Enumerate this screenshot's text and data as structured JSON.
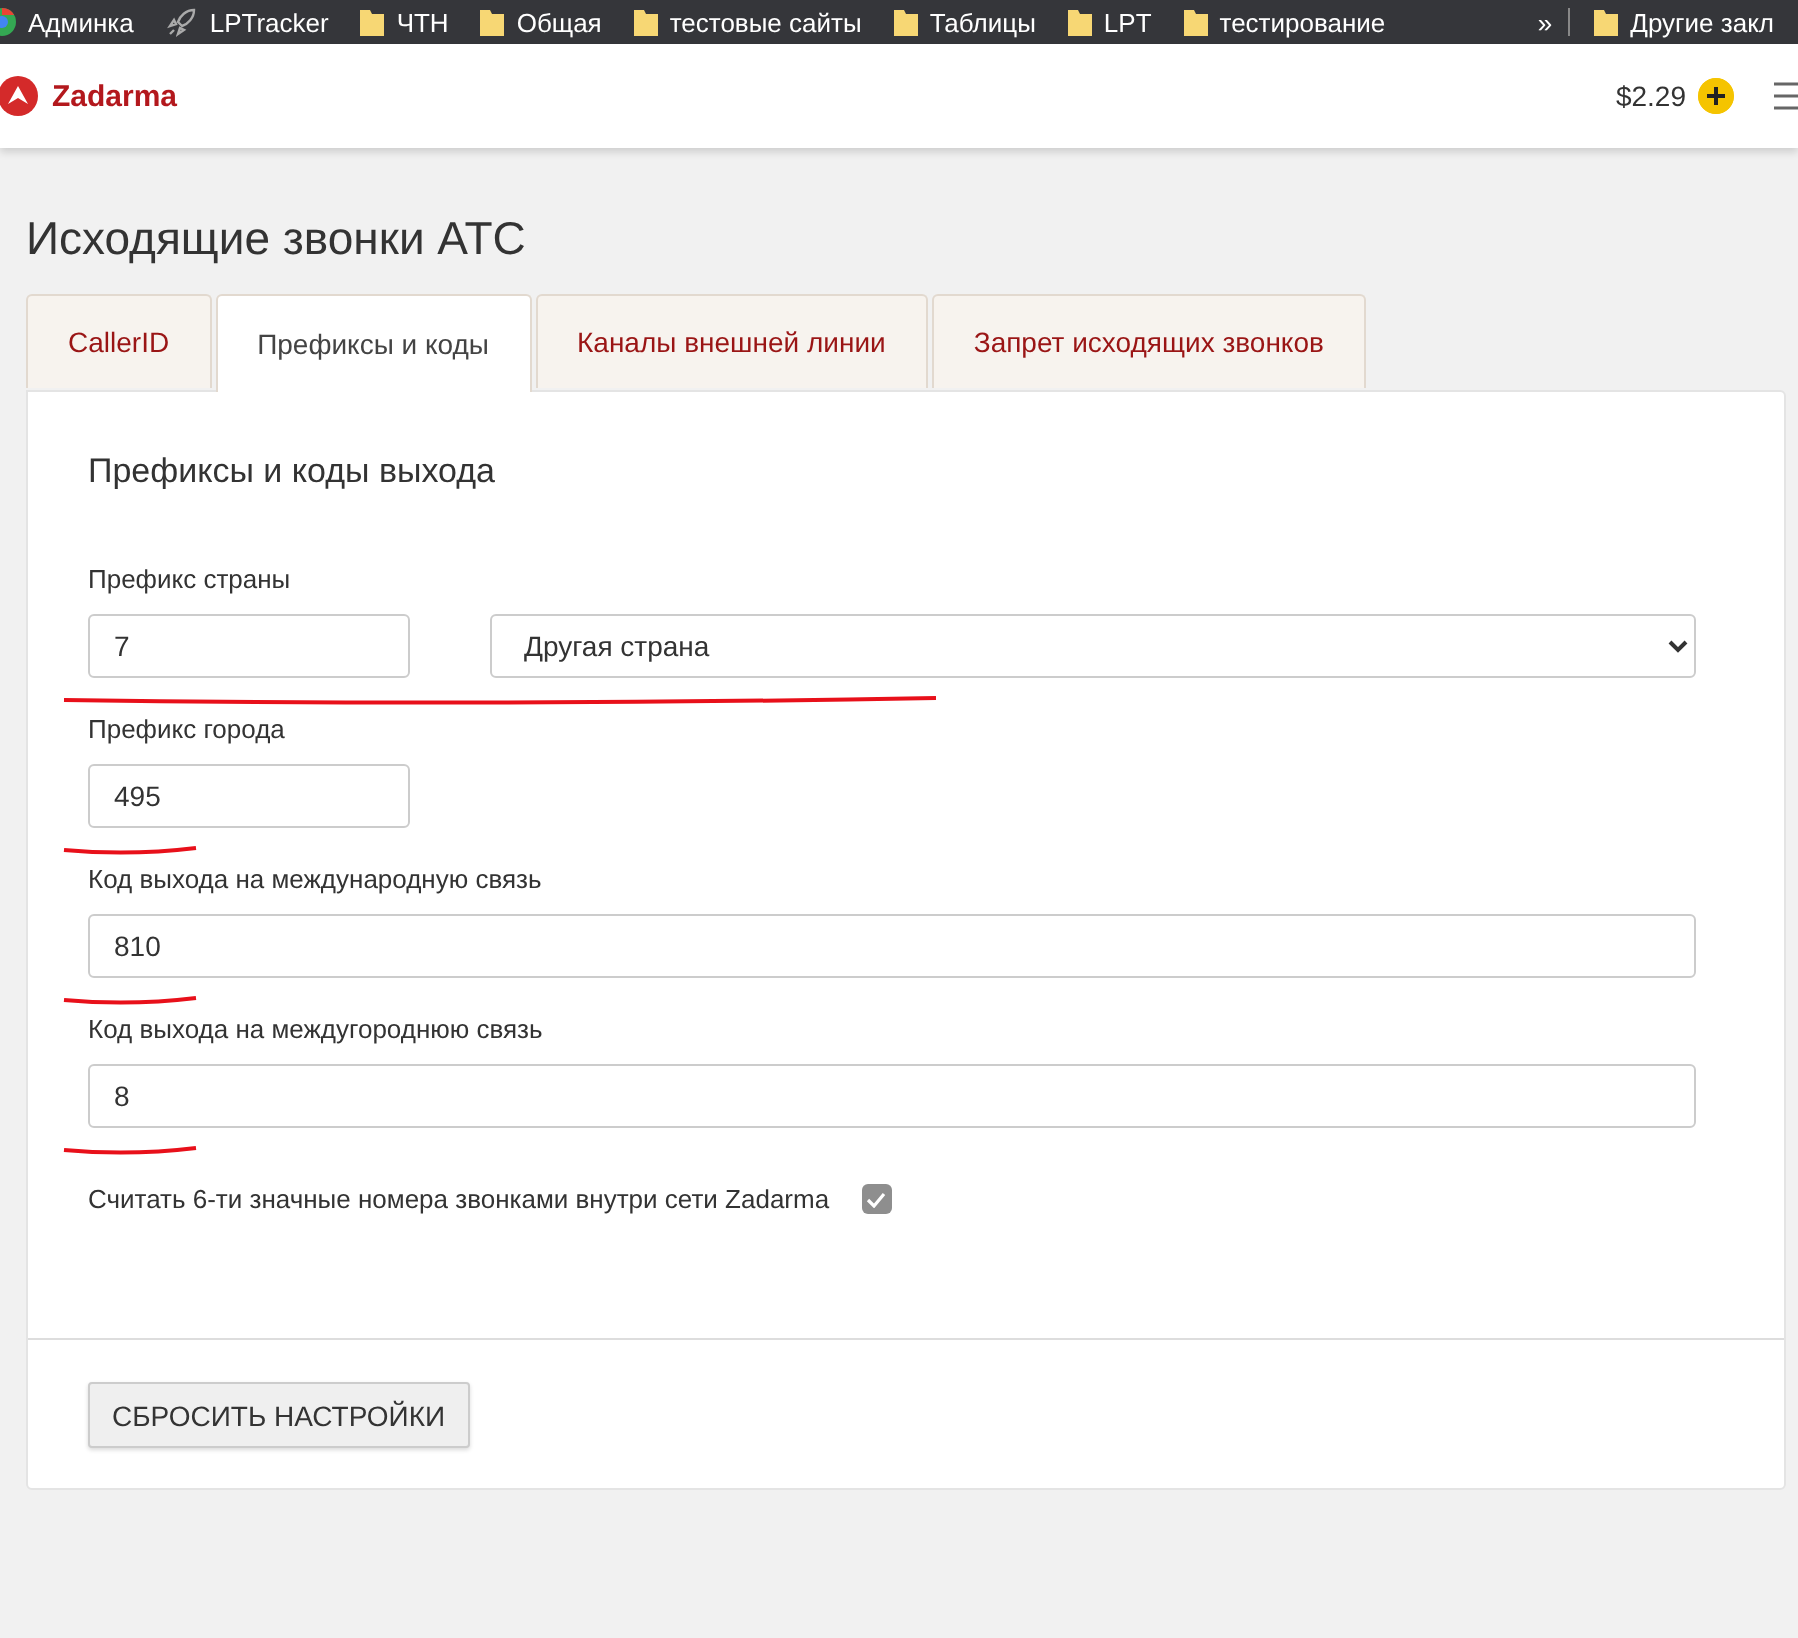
{
  "bookmarks": {
    "items": [
      {
        "kind": "site",
        "label": "Админка"
      },
      {
        "kind": "rocket",
        "label": "LPTracker"
      },
      {
        "kind": "folder",
        "label": "ЧТН"
      },
      {
        "kind": "folder",
        "label": "Общая"
      },
      {
        "kind": "folder",
        "label": "тестовые сайты"
      },
      {
        "kind": "folder",
        "label": "Таблицы"
      },
      {
        "kind": "folder",
        "label": "LPT"
      },
      {
        "kind": "folder",
        "label": "тестирование"
      }
    ],
    "more": "»",
    "other": "Другие закл"
  },
  "header": {
    "brand": "Zadarma",
    "balance": "$2.29"
  },
  "page_title": "Исходящие звонки АТС",
  "tabs": [
    {
      "label": "CallerID",
      "selected": false
    },
    {
      "label": "Префиксы и коды",
      "selected": true
    },
    {
      "label": "Каналы внешней линии",
      "selected": false
    },
    {
      "label": "Запрет исходящих звонков",
      "selected": false
    }
  ],
  "section_title": "Префиксы и коды выхода",
  "fields": [
    {
      "label": "Префикс страны",
      "value": "7",
      "kind": "short",
      "select": "Другая страна",
      "underlined": true
    },
    {
      "label": "Префикс города",
      "value": "495",
      "kind": "short",
      "underlined": true
    },
    {
      "label": "Код выхода на международную связь",
      "value": "810",
      "kind": "long",
      "underlined": true
    },
    {
      "label": "Код выхода на междугороднюю связь",
      "value": "8",
      "kind": "long",
      "underlined": true
    }
  ],
  "checkbox": {
    "label": "Считать 6-ти значные номера звонками внутри сети Zadarma",
    "checked": true,
    "disabled": true
  },
  "reset_button": "СБРОСИТЬ НАСТРОЙКИ"
}
